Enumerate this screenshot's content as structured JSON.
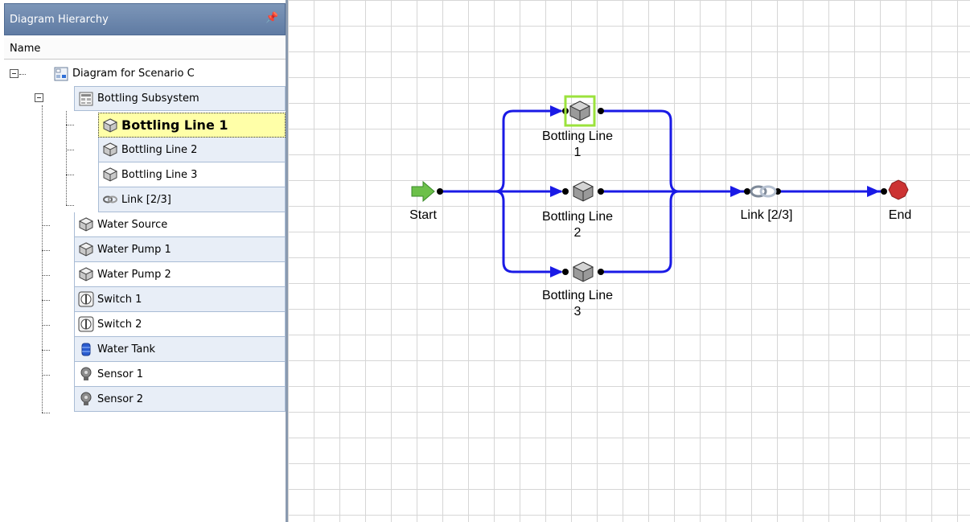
{
  "panel": {
    "title": "Diagram Hierarchy",
    "pin_icon": "pin-icon",
    "column_header": "Name"
  },
  "tree": {
    "root": {
      "label": "Diagram for Scenario C",
      "icon": "diagram-icon"
    },
    "items": [
      {
        "label": "Bottling Subsystem",
        "icon": "subsystem-icon"
      },
      {
        "label": "Bottling Line 1",
        "icon": "cube-icon"
      },
      {
        "label": "Bottling Line 2",
        "icon": "cube-icon"
      },
      {
        "label": "Bottling Line 3",
        "icon": "cube-icon"
      },
      {
        "label": "Link [2/3]",
        "icon": "link-icon"
      },
      {
        "label": "Water Source",
        "icon": "cube-icon"
      },
      {
        "label": "Water Pump 1",
        "icon": "cube-icon"
      },
      {
        "label": "Water Pump 2",
        "icon": "cube-icon"
      },
      {
        "label": "Switch 1",
        "icon": "switch-icon"
      },
      {
        "label": "Switch 2",
        "icon": "switch-icon"
      },
      {
        "label": "Water Tank",
        "icon": "tank-icon"
      },
      {
        "label": "Sensor 1",
        "icon": "sensor-icon"
      },
      {
        "label": "Sensor 2",
        "icon": "sensor-icon"
      }
    ],
    "selected": "Bottling Line 1"
  },
  "diagram": {
    "start_label": "Start",
    "end_label": "End",
    "link_label": "Link [2/3]",
    "line1_label": "Bottling Line\n1",
    "line2_label": "Bottling Line\n2",
    "line3_label": "Bottling Line\n3",
    "connector_color": "#1a1ae6",
    "selection_color": "#9be23c",
    "start_color": "#6cc04a",
    "end_color": "#cc3333"
  }
}
